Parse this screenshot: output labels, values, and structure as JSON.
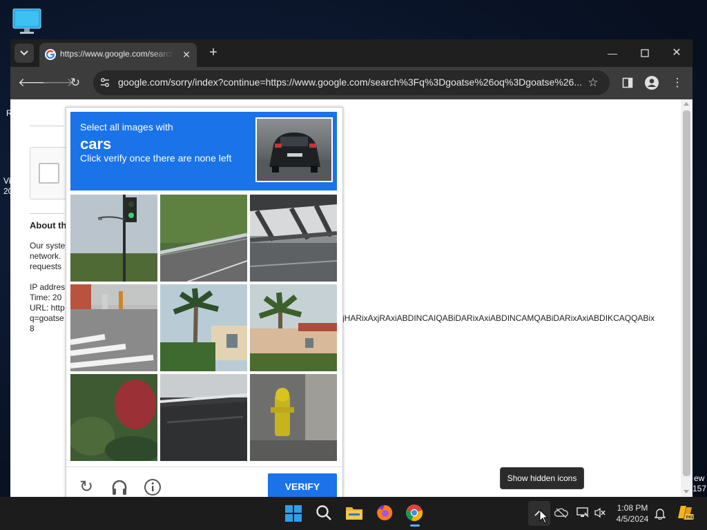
{
  "desktop": {
    "icon": "computer-icon",
    "edge_left_texts": [
      "R",
      "Vi",
      "20"
    ],
    "edge_right_texts": [
      "ew",
      "157"
    ]
  },
  "browser": {
    "tab": {
      "title": "https://www.google.com/search?q=goatse",
      "favicon": "google-g-icon"
    },
    "address": "google.com/sorry/index?continue=https://www.google.com/search%3Fq%3Dgoatse%26oq%3Dgoatse%26...",
    "icons": {
      "back": "arrow-left-icon",
      "forward": "arrow-right-icon",
      "reload": "reload-icon",
      "tune": "tune-icon",
      "star": "star-icon",
      "sidepanel": "side-panel-icon",
      "profile": "profile-icon",
      "menu": "kebab-menu-icon"
    }
  },
  "page": {
    "about_heading": "About th",
    "paragraph": [
      "Our syste",
      "network.",
      "requests"
    ],
    "details": [
      "IP addres",
      "Time: 20",
      "URL: http",
      "q=goatse",
      "8"
    ],
    "url_tail": "jHARixAxjRAxiABDINCAIQABiDARixAxiABDINCAMQABiDARixAxiABDIKCAQQABix"
  },
  "captcha": {
    "line1": "Select all images with",
    "object": "cars",
    "line2": "Click verify once there are none left",
    "verify_label": "VERIFY",
    "tiles": [
      "traffic-light",
      "highway-guardrail",
      "bridge-structure",
      "crosswalk-hydrant",
      "palm-tree-house",
      "palm-tree-building",
      "red-plant",
      "dark-vehicle-part",
      "yellow-hydrant"
    ],
    "footer_icons": [
      "reload-icon",
      "headphones-icon",
      "info-icon"
    ]
  },
  "tooltip": "Show hidden icons",
  "taskbar": {
    "apps": [
      "windows-start-icon",
      "search-icon",
      "file-explorer-icon",
      "firefox-icon",
      "chrome-icon"
    ],
    "time": "1:08 PM",
    "date": "4/5/2024",
    "tray_icons": [
      "chevron-up-icon",
      "onedrive-icon",
      "network-icon",
      "volume-icon",
      "notification-bell-icon",
      "copilot-pre-icon"
    ]
  }
}
